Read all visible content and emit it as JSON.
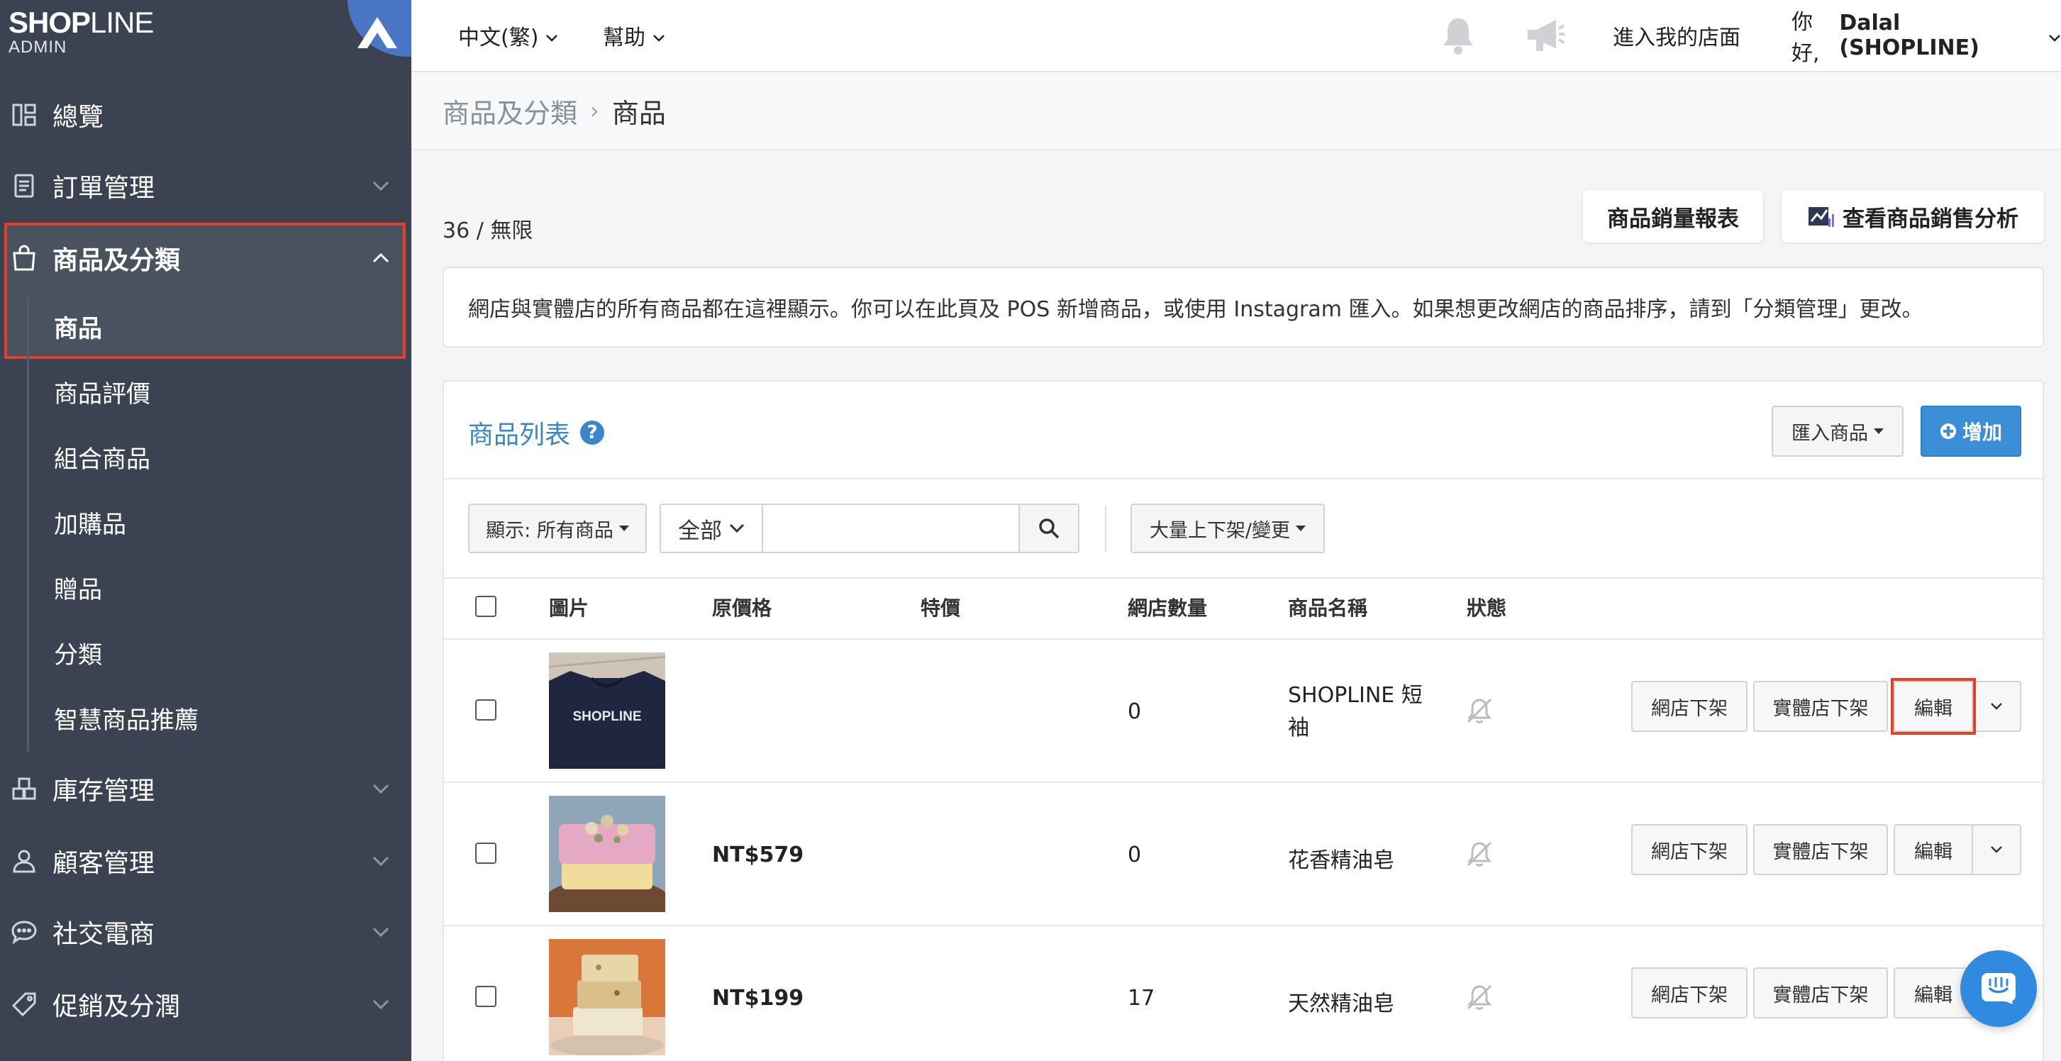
{
  "logo": {
    "bold": "SHOP",
    "light": "LINE",
    "sub": "ADMIN"
  },
  "sidebar": {
    "items": [
      {
        "label": "總覽",
        "icon": "dashboard-icon"
      },
      {
        "label": "訂單管理",
        "icon": "order-icon"
      },
      {
        "label": "商品及分類",
        "icon": "bag-icon"
      },
      {
        "label": "庫存管理",
        "icon": "inventory-icon"
      },
      {
        "label": "顧客管理",
        "icon": "user-icon"
      },
      {
        "label": "社交電商",
        "icon": "chat-icon"
      },
      {
        "label": "促銷及分潤",
        "icon": "tag-icon"
      }
    ],
    "subitems": [
      "商品",
      "商品評價",
      "組合商品",
      "加購品",
      "贈品",
      "分類",
      "智慧商品推薦"
    ],
    "active_color": "#e0412a"
  },
  "topbar": {
    "language": "中文(繁)",
    "help": "幫助",
    "storefront": "進入我的店面",
    "greeting_prefix": "你好, ",
    "greeting_name": "Dalal (SHOPLINE)"
  },
  "breadcrumb": {
    "parent": "商品及分類",
    "separator": "›",
    "current": "商品"
  },
  "main": {
    "count": "36 / 無限",
    "sales_report": "商品銷量報表",
    "sales_analysis": "查看商品銷售分析",
    "info": "網店與實體店的所有商品都在這裡顯示。你可以在此頁及 POS 新增商品，或使用 Instagram 匯入。如果想更改網店的商品排序，請到「分類管理」更改。"
  },
  "panel": {
    "title": "商品列表",
    "help": "?",
    "import": "匯入商品",
    "add": "增加",
    "filter_display": "顯示: 所有商品",
    "filter_scope": "全部",
    "search_value": "",
    "bulk": "大量上下架/變更",
    "columns": [
      "圖片",
      "原價格",
      "特價",
      "網店數量",
      "商品名稱",
      "狀態"
    ],
    "row_actions": {
      "offline_web": "網店下架",
      "offline_store": "實體店下架",
      "edit": "編輯"
    },
    "rows": [
      {
        "price": "",
        "special": "",
        "qty": "0",
        "name": "SHOPLINE 短袖",
        "thumb_text": "SHOPLINE"
      },
      {
        "price": "NT$579",
        "special": "",
        "qty": "0",
        "name": "花香精油皂",
        "thumb_text": ""
      },
      {
        "price": "NT$199",
        "special": "",
        "qty": "17",
        "name": "天然精油皂",
        "thumb_text": ""
      }
    ]
  },
  "colors": {
    "sidebar": "#3b4251",
    "accent_blue": "#3a8fd6",
    "highlight_red": "#e0412a"
  }
}
